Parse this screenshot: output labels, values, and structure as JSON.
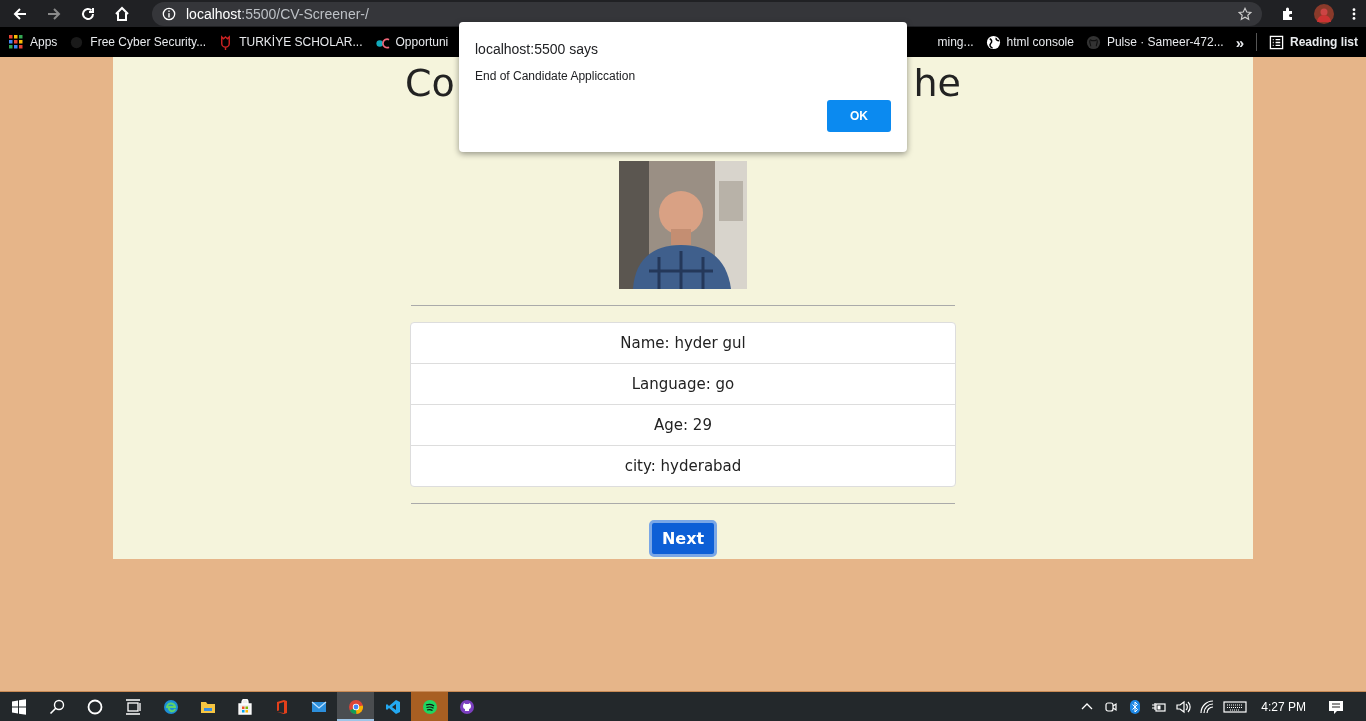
{
  "browser": {
    "url_host": "localhost",
    "url_path": ":5500/CV-Screener-/",
    "bookmarks_left": [
      {
        "kind": "apps",
        "label": "Apps"
      },
      {
        "kind": "blank",
        "label": "Free Cyber Security..."
      },
      {
        "kind": "tulip",
        "label": "TURKİYE SCHOLAR..."
      },
      {
        "kind": "oc",
        "label": "Opportuni"
      }
    ],
    "bookmarks_right": [
      {
        "kind": "none",
        "label": "ming..."
      },
      {
        "kind": "globe",
        "label": "html console"
      },
      {
        "kind": "github",
        "label": "Pulse · Sameer-472..."
      }
    ],
    "overflow": "»",
    "reading_list": "Reading list"
  },
  "page": {
    "heading_left": "Co",
    "heading_right": "he",
    "details": [
      "Name: hyder gul",
      "Language: go",
      "Age: 29",
      "city: hyderabad"
    ],
    "next_button": "Next"
  },
  "dialog": {
    "title": "localhost:5500 says",
    "message": "End of Candidate Appliccation",
    "button": "OK"
  },
  "taskbar": {
    "apps": [
      {
        "kind": "edge",
        "selected": false,
        "flashing": false
      },
      {
        "kind": "folder",
        "selected": false,
        "flashing": false
      },
      {
        "kind": "store",
        "selected": false,
        "flashing": false
      },
      {
        "kind": "office",
        "selected": false,
        "flashing": false
      },
      {
        "kind": "mail",
        "selected": false,
        "flashing": false
      },
      {
        "kind": "chrome",
        "selected": true,
        "flashing": false
      },
      {
        "kind": "vscode",
        "selected": false,
        "flashing": false
      },
      {
        "kind": "spotify",
        "selected": false,
        "flashing": true
      },
      {
        "kind": "github",
        "selected": false,
        "flashing": false
      }
    ],
    "time": "4:27 PM"
  }
}
